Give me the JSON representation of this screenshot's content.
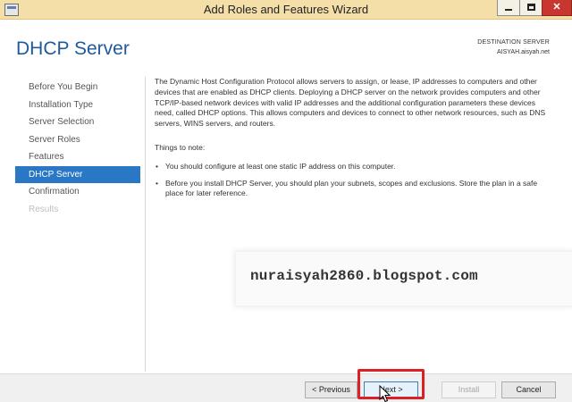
{
  "window": {
    "title": "Add Roles and Features Wizard",
    "controls": {
      "minimize_icon": "minimize-icon",
      "maximize_icon": "maximize-icon",
      "close_symbol": "✕"
    }
  },
  "header": {
    "page_title": "DHCP Server",
    "destination_label": "DESTINATION SERVER",
    "destination_value": "AISYAH.aisyah.net"
  },
  "nav": {
    "items": [
      {
        "label": "Before You Begin",
        "state": "normal"
      },
      {
        "label": "Installation Type",
        "state": "normal"
      },
      {
        "label": "Server Selection",
        "state": "normal"
      },
      {
        "label": "Server Roles",
        "state": "normal"
      },
      {
        "label": "Features",
        "state": "normal"
      },
      {
        "label": "DHCP Server",
        "state": "active"
      },
      {
        "label": "Confirmation",
        "state": "normal"
      },
      {
        "label": "Results",
        "state": "disabled"
      }
    ]
  },
  "content": {
    "intro": "The Dynamic Host Configuration Protocol allows servers to assign, or lease, IP addresses to computers and other devices that are enabled as DHCP clients. Deploying a DHCP server on the network provides computers and other TCP/IP-based network devices with valid IP addresses and the additional configuration parameters these devices need, called DHCP options. This allows computers and devices to connect to other network resources, such as DNS servers, WINS servers, and routers.",
    "notes_heading": "Things to note:",
    "notes": [
      "You should configure at least one static IP address on this computer.",
      "Before you install DHCP Server, you should plan your subnets, scopes and exclusions. Store the plan in a safe place for later reference."
    ]
  },
  "watermark": {
    "text": "nuraisyah2860.blogspot.com"
  },
  "footer": {
    "previous_label": "< Previous",
    "next_label": "Next >",
    "install_label": "Install",
    "cancel_label": "Cancel"
  },
  "colors": {
    "titlebar": "#f4dfa9",
    "accent": "#2a78c5",
    "title_blue": "#1e5a9c",
    "highlight": "#dd1f26",
    "close_button": "#c7372f"
  }
}
